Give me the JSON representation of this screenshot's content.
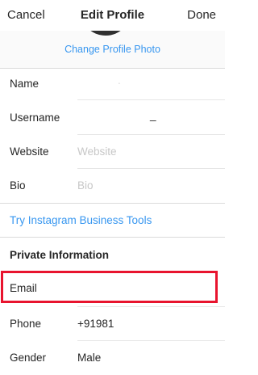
{
  "header": {
    "cancel_label": "Cancel",
    "title": "Edit Profile",
    "done_label": "Done"
  },
  "photo": {
    "change_label": "Change Profile Photo"
  },
  "fields": {
    "name": {
      "label": "Name",
      "value": "."
    },
    "username": {
      "label": "Username",
      "value": "_"
    },
    "website": {
      "label": "Website",
      "placeholder": "Website"
    },
    "bio": {
      "label": "Bio",
      "placeholder": "Bio"
    }
  },
  "business_tools_label": "Try Instagram Business Tools",
  "private": {
    "heading": "Private Information",
    "email": {
      "label": "Email",
      "value": ""
    },
    "phone": {
      "label": "Phone",
      "value": "+91981"
    },
    "gender": {
      "label": "Gender",
      "value": "Male"
    }
  },
  "colors": {
    "accent": "#3897f0",
    "highlight": "#e8142e",
    "placeholder": "#c7c7c7"
  }
}
